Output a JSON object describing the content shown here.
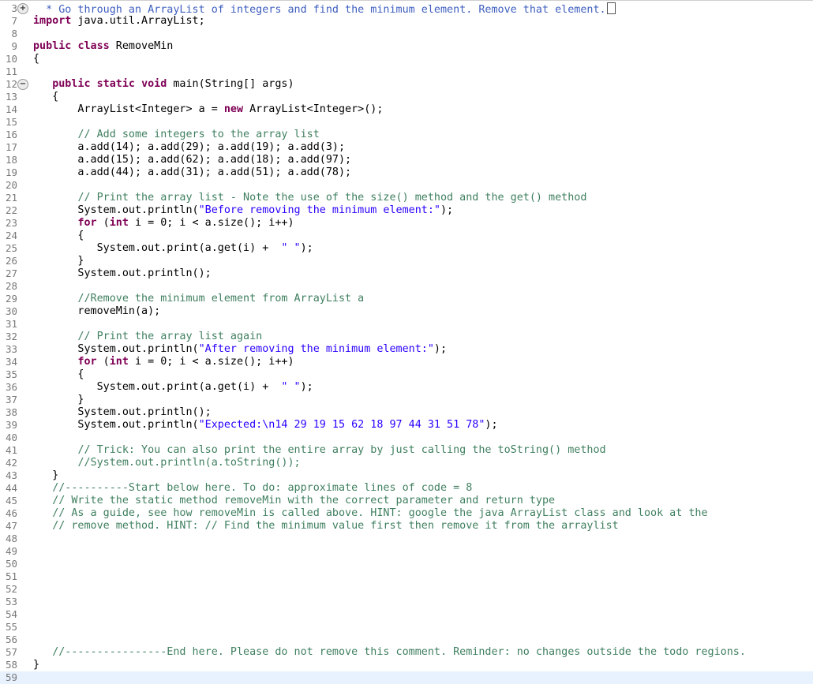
{
  "editor": {
    "language": "java",
    "current_line": 59,
    "colors": {
      "keyword": "#7f0055",
      "comment": "#3f7f5f",
      "javadoc": "#3f5fbf",
      "string": "#2a00ff",
      "line_number": "#787878",
      "current_line_bg": "#e8f2fe"
    },
    "lines": [
      {
        "n": "3",
        "fold": "expand",
        "tokens": [
          {
            "t": "jd",
            "v": "  * Go through an ArrayList of integers and find the minimum element. Remove that element."
          }
        ],
        "collapsed": true
      },
      {
        "n": "7",
        "tokens": [
          {
            "t": "k",
            "v": "import"
          },
          {
            "t": "",
            "v": " java.util.ArrayList;"
          }
        ]
      },
      {
        "n": "8",
        "tokens": []
      },
      {
        "n": "9",
        "tokens": [
          {
            "t": "k",
            "v": "public"
          },
          {
            "t": "",
            "v": " "
          },
          {
            "t": "k",
            "v": "class"
          },
          {
            "t": "",
            "v": " RemoveMin"
          }
        ]
      },
      {
        "n": "10",
        "tokens": [
          {
            "t": "",
            "v": "{"
          }
        ]
      },
      {
        "n": "11",
        "tokens": []
      },
      {
        "n": "12",
        "fold": "collapse",
        "tokens": [
          {
            "t": "",
            "v": "   "
          },
          {
            "t": "k",
            "v": "public"
          },
          {
            "t": "",
            "v": " "
          },
          {
            "t": "k",
            "v": "static"
          },
          {
            "t": "",
            "v": " "
          },
          {
            "t": "k",
            "v": "void"
          },
          {
            "t": "",
            "v": " main(String[] args)"
          }
        ]
      },
      {
        "n": "13",
        "tokens": [
          {
            "t": "",
            "v": "   {"
          }
        ]
      },
      {
        "n": "14",
        "tokens": [
          {
            "t": "",
            "v": "       ArrayList<Integer> a = "
          },
          {
            "t": "k",
            "v": "new"
          },
          {
            "t": "",
            "v": " ArrayList<Integer>();"
          }
        ]
      },
      {
        "n": "15",
        "tokens": []
      },
      {
        "n": "16",
        "tokens": [
          {
            "t": "",
            "v": "       "
          },
          {
            "t": "c",
            "v": "// Add some integers to the array list"
          }
        ]
      },
      {
        "n": "17",
        "tokens": [
          {
            "t": "",
            "v": "       a.add(14); a.add(29); a.add(19); a.add(3);"
          }
        ]
      },
      {
        "n": "18",
        "tokens": [
          {
            "t": "",
            "v": "       a.add(15); a.add(62); a.add(18); a.add(97);"
          }
        ]
      },
      {
        "n": "19",
        "tokens": [
          {
            "t": "",
            "v": "       a.add(44); a.add(31); a.add(51); a.add(78);"
          }
        ]
      },
      {
        "n": "20",
        "tokens": []
      },
      {
        "n": "21",
        "tokens": [
          {
            "t": "",
            "v": "       "
          },
          {
            "t": "c",
            "v": "// Print the array list - Note the use of the size() method and the get() method"
          }
        ]
      },
      {
        "n": "22",
        "tokens": [
          {
            "t": "",
            "v": "       System.out.println("
          },
          {
            "t": "s",
            "v": "\"Before removing the minimum element:\""
          },
          {
            "t": "",
            "v": ");"
          }
        ]
      },
      {
        "n": "23",
        "tokens": [
          {
            "t": "",
            "v": "       "
          },
          {
            "t": "k",
            "v": "for"
          },
          {
            "t": "",
            "v": " ("
          },
          {
            "t": "k",
            "v": "int"
          },
          {
            "t": "",
            "v": " i = 0; i < a.size(); i++)"
          }
        ]
      },
      {
        "n": "24",
        "tokens": [
          {
            "t": "",
            "v": "       {"
          }
        ]
      },
      {
        "n": "25",
        "tokens": [
          {
            "t": "",
            "v": "          System.out.print(a.get(i) +  "
          },
          {
            "t": "s",
            "v": "\" \""
          },
          {
            "t": "",
            "v": ");"
          }
        ]
      },
      {
        "n": "26",
        "tokens": [
          {
            "t": "",
            "v": "       }"
          }
        ]
      },
      {
        "n": "27",
        "tokens": [
          {
            "t": "",
            "v": "       System.out.println();"
          }
        ]
      },
      {
        "n": "28",
        "tokens": []
      },
      {
        "n": "29",
        "tokens": [
          {
            "t": "",
            "v": "       "
          },
          {
            "t": "c",
            "v": "//Remove the minimum element from ArrayList a"
          }
        ]
      },
      {
        "n": "30",
        "tokens": [
          {
            "t": "",
            "v": "       removeMin(a);"
          }
        ]
      },
      {
        "n": "31",
        "tokens": []
      },
      {
        "n": "32",
        "tokens": [
          {
            "t": "",
            "v": "       "
          },
          {
            "t": "c",
            "v": "// Print the array list again"
          }
        ]
      },
      {
        "n": "33",
        "tokens": [
          {
            "t": "",
            "v": "       System.out.println("
          },
          {
            "t": "s",
            "v": "\"After removing the minimum element:\""
          },
          {
            "t": "",
            "v": ");"
          }
        ]
      },
      {
        "n": "34",
        "tokens": [
          {
            "t": "",
            "v": "       "
          },
          {
            "t": "k",
            "v": "for"
          },
          {
            "t": "",
            "v": " ("
          },
          {
            "t": "k",
            "v": "int"
          },
          {
            "t": "",
            "v": " i = 0; i < a.size(); i++)"
          }
        ]
      },
      {
        "n": "35",
        "tokens": [
          {
            "t": "",
            "v": "       {"
          }
        ]
      },
      {
        "n": "36",
        "tokens": [
          {
            "t": "",
            "v": "          System.out.print(a.get(i) +  "
          },
          {
            "t": "s",
            "v": "\" \""
          },
          {
            "t": "",
            "v": ");"
          }
        ]
      },
      {
        "n": "37",
        "tokens": [
          {
            "t": "",
            "v": "       }"
          }
        ]
      },
      {
        "n": "38",
        "tokens": [
          {
            "t": "",
            "v": "       System.out.println();"
          }
        ]
      },
      {
        "n": "39",
        "tokens": [
          {
            "t": "",
            "v": "       System.out.println("
          },
          {
            "t": "s",
            "v": "\"Expected:\\n14 29 19 15 62 18 97 44 31 51 78\""
          },
          {
            "t": "",
            "v": ");"
          }
        ]
      },
      {
        "n": "40",
        "tokens": []
      },
      {
        "n": "41",
        "tokens": [
          {
            "t": "",
            "v": "       "
          },
          {
            "t": "c",
            "v": "// Trick: You can also print the entire array by just calling the toString() method"
          }
        ]
      },
      {
        "n": "42",
        "tokens": [
          {
            "t": "",
            "v": "       "
          },
          {
            "t": "c",
            "v": "//System.out.println(a.toString());"
          }
        ]
      },
      {
        "n": "43",
        "tokens": [
          {
            "t": "",
            "v": "   }"
          }
        ]
      },
      {
        "n": "44",
        "tokens": [
          {
            "t": "",
            "v": "   "
          },
          {
            "t": "c",
            "v": "//----------Start below here. To do: approximate lines of code = 8"
          }
        ]
      },
      {
        "n": "45",
        "tokens": [
          {
            "t": "",
            "v": "   "
          },
          {
            "t": "c",
            "v": "// Write the static method removeMin with the correct parameter and return type"
          }
        ]
      },
      {
        "n": "46",
        "tokens": [
          {
            "t": "",
            "v": "   "
          },
          {
            "t": "c",
            "v": "// As a guide, see how removeMin is called above. HINT: google the java ArrayList class and look at the"
          }
        ]
      },
      {
        "n": "47",
        "tokens": [
          {
            "t": "",
            "v": "   "
          },
          {
            "t": "c",
            "v": "// remove method. HINT: // Find the minimum value first then remove it from the arraylist"
          }
        ]
      },
      {
        "n": "48",
        "tokens": []
      },
      {
        "n": "49",
        "tokens": []
      },
      {
        "n": "50",
        "tokens": []
      },
      {
        "n": "51",
        "tokens": []
      },
      {
        "n": "52",
        "tokens": []
      },
      {
        "n": "53",
        "tokens": []
      },
      {
        "n": "54",
        "tokens": []
      },
      {
        "n": "55",
        "tokens": []
      },
      {
        "n": "56",
        "tokens": []
      },
      {
        "n": "57",
        "tokens": [
          {
            "t": "",
            "v": "   "
          },
          {
            "t": "c",
            "v": "//----------------End here. Please do not remove this comment. Reminder: no changes outside the todo regions."
          }
        ]
      },
      {
        "n": "58",
        "tokens": [
          {
            "t": "",
            "v": "}"
          }
        ]
      },
      {
        "n": "59",
        "tokens": []
      }
    ]
  }
}
